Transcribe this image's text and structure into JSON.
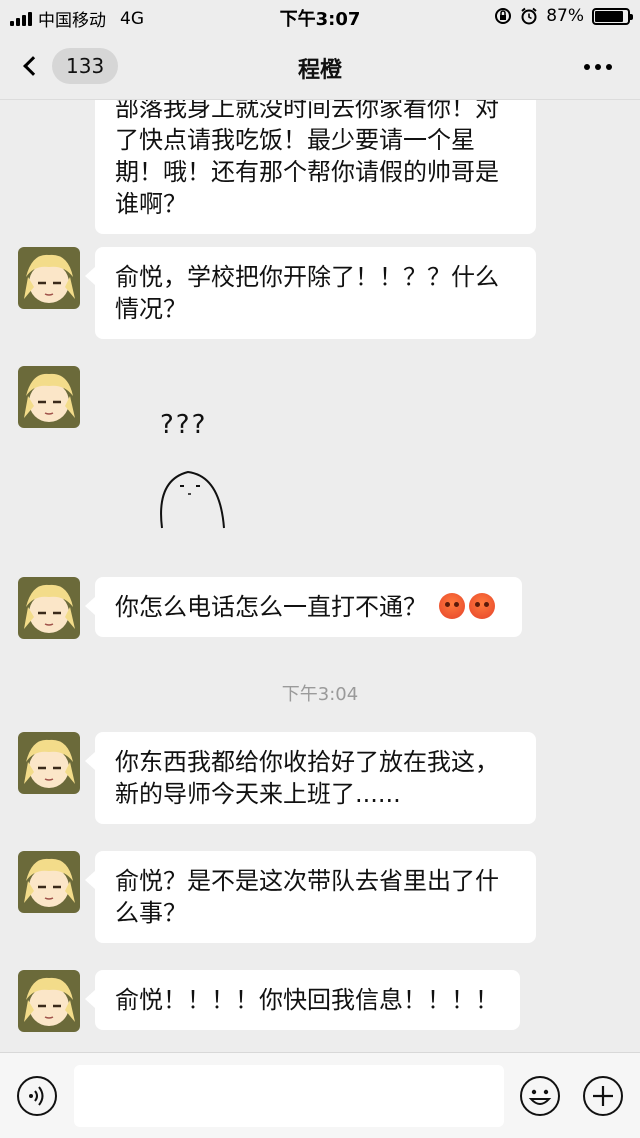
{
  "status_bar": {
    "carrier": "中国移动",
    "network": "4G",
    "time": "下午3:07",
    "battery": "87%",
    "battery_level": 0.87
  },
  "nav": {
    "unread_count": "133",
    "title": "程橙"
  },
  "messages": [
    {
      "lines": [
        "部落我身上就没时间去你家看你！对",
        "了快点请我吃饭！最少要请一个星",
        "期！哦！还有那个帮你请假的帅哥是",
        "谁啊？"
      ]
    },
    {
      "lines": [
        "俞悦，学校把你开除了！！？？什么",
        "情况？"
      ]
    },
    {
      "sticker_text": "???"
    },
    {
      "text": "你怎么电话怎么一直打不通？"
    },
    {
      "timestamp": "下午3:04"
    },
    {
      "lines": [
        "你东西我都给你收拾好了放在我这，",
        "新的导师今天来上班了......"
      ]
    },
    {
      "lines": [
        "俞悦？是不是这次带队去省里出了什",
        "么事？"
      ]
    },
    {
      "text": "俞悦！！！！你快回我信息！！！！"
    }
  ],
  "icons": {
    "voice": "voice-icon",
    "emoji": "emoji-icon",
    "plus": "plus-icon",
    "angry_emoji": "angry-face-emoji"
  },
  "colors": {
    "background": "#ededed",
    "bubble": "#ffffff",
    "timestamp": "#9a9a9a"
  }
}
